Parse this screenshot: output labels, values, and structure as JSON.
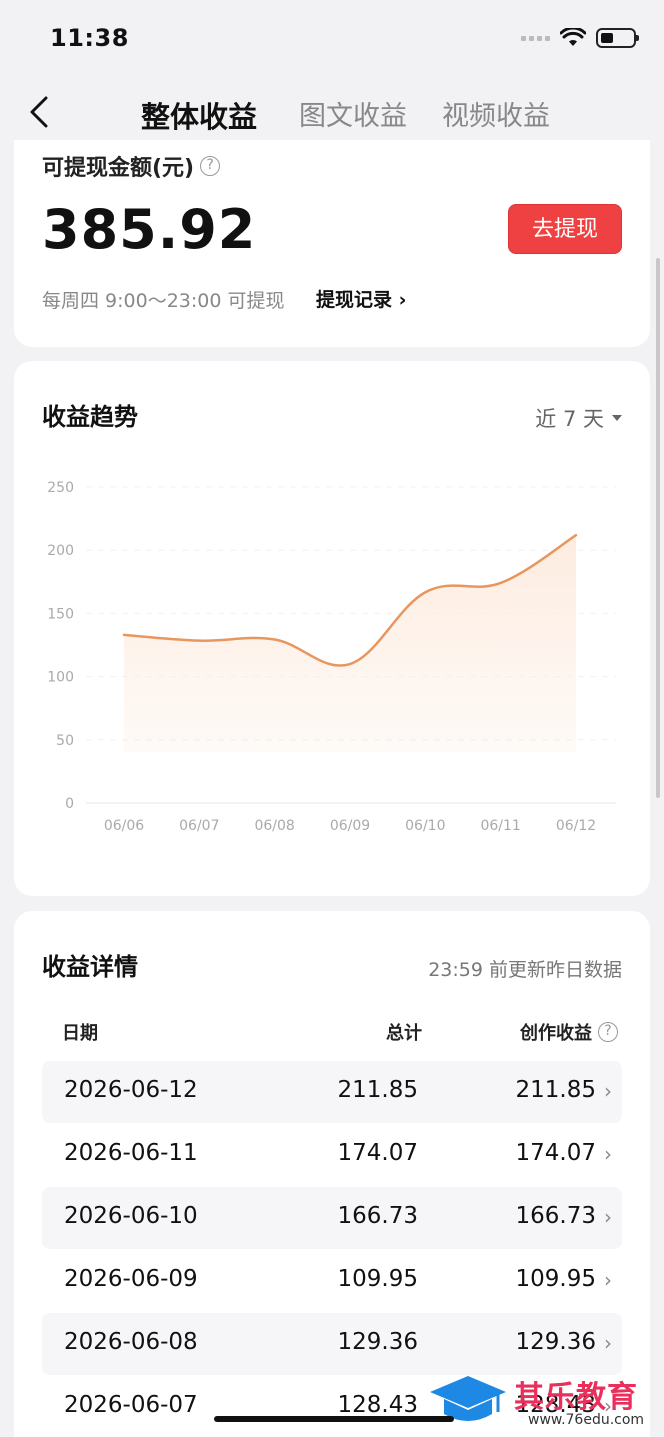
{
  "status": {
    "time": "11:38"
  },
  "nav": {
    "tabs": [
      {
        "label": "整体收益",
        "active": true
      },
      {
        "label": "图文收益",
        "active": false
      },
      {
        "label": "视频收益",
        "active": false
      }
    ]
  },
  "balance": {
    "label": "可提现金额(元)",
    "value": "385.92",
    "withdraw_label": "去提现",
    "schedule": "每周四 9:00～23:00 可提现",
    "record_label": "提现记录"
  },
  "trend": {
    "title": "收益趋势",
    "range_label": "近 7 天"
  },
  "chart_data": {
    "type": "area",
    "title": "",
    "xlabel": "",
    "ylabel": "",
    "categories": [
      "06/06",
      "06/07",
      "06/08",
      "06/09",
      "06/10",
      "06/11",
      "06/12"
    ],
    "values": [
      133,
      128.43,
      129.36,
      109.95,
      166.73,
      174.07,
      211.85
    ],
    "ylim": [
      0,
      250
    ],
    "yticks": [
      0,
      50,
      100,
      150,
      200,
      250
    ],
    "grid": true,
    "legend": "none",
    "line_color": "#e8965e",
    "fill_color": "#fdece0"
  },
  "details": {
    "title": "收益详情",
    "update_note": "23:59 前更新昨日数据",
    "columns": {
      "date": "日期",
      "total": "总计",
      "creation": "创作收益"
    },
    "rows": [
      {
        "date": "2026-06-12",
        "total": "211.85",
        "creation": "211.85"
      },
      {
        "date": "2026-06-11",
        "total": "174.07",
        "creation": "174.07"
      },
      {
        "date": "2026-06-10",
        "total": "166.73",
        "creation": "166.73"
      },
      {
        "date": "2026-06-09",
        "total": "109.95",
        "creation": "109.95"
      },
      {
        "date": "2026-06-08",
        "total": "129.36",
        "creation": "129.36"
      },
      {
        "date": "2026-06-07",
        "total": "128.43",
        "creation": "128.43"
      }
    ]
  },
  "watermark": {
    "text": "其乐教育",
    "url": "www.76edu.com"
  },
  "colors": {
    "accent": "#f04142",
    "background": "#f2f2f5"
  }
}
